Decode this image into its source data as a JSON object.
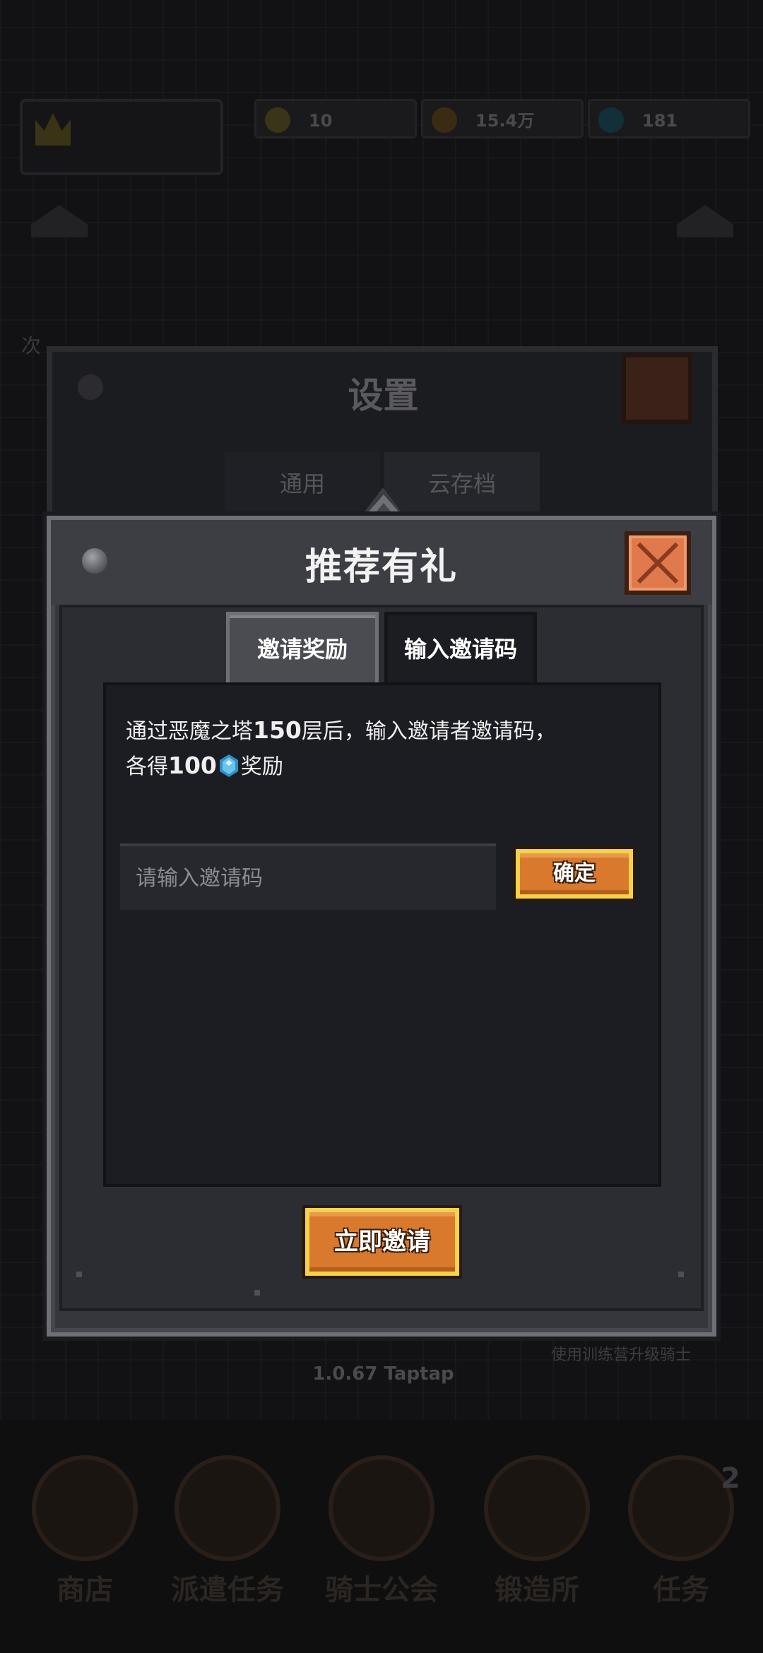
{
  "background": {
    "resources": [
      {
        "icon": "trophy-icon",
        "value": "10"
      },
      {
        "icon": "coin-icon",
        "value": "15.4万"
      },
      {
        "icon": "gem-icon",
        "value": "181"
      }
    ],
    "side_label_left": "次",
    "version": "1.0.67 Taptap",
    "hint": "使用训练营升级骑士",
    "bottom_nav": [
      {
        "label": "商店",
        "icon": "shop-icon"
      },
      {
        "label": "派遣任务",
        "icon": "dispatch-icon"
      },
      {
        "label": "骑士公会",
        "icon": "vip-knight-icon"
      },
      {
        "label": "锻造所",
        "icon": "forge-icon"
      },
      {
        "label": "任务",
        "icon": "quest-icon",
        "badge": "2"
      }
    ]
  },
  "settings": {
    "title": "设置",
    "tabs": [
      "通用",
      "云存档"
    ]
  },
  "dialog": {
    "title": "推荐有礼",
    "tabs": [
      {
        "label": "邀请奖励",
        "active": true
      },
      {
        "label": "输入邀请码",
        "active": false
      }
    ],
    "description": {
      "line1_prefix": "通过恶魔之塔",
      "line1_floor": "150",
      "line1_suffix": "层后，输入邀请者邀请码，",
      "line2_prefix": "各得",
      "line2_amount": "100",
      "line2_suffix": "奖励",
      "reward_icon": "gem-icon"
    },
    "code_input": {
      "placeholder": "请输入邀请码",
      "value": ""
    },
    "confirm_label": "确定",
    "invite_now_label": "立即邀请"
  },
  "colors": {
    "gold_border": "#f5d24a",
    "button_orange": "#d8792e",
    "close_orange": "#e07a4c",
    "panel": "#35373d",
    "content_bg": "#1c1d22"
  }
}
